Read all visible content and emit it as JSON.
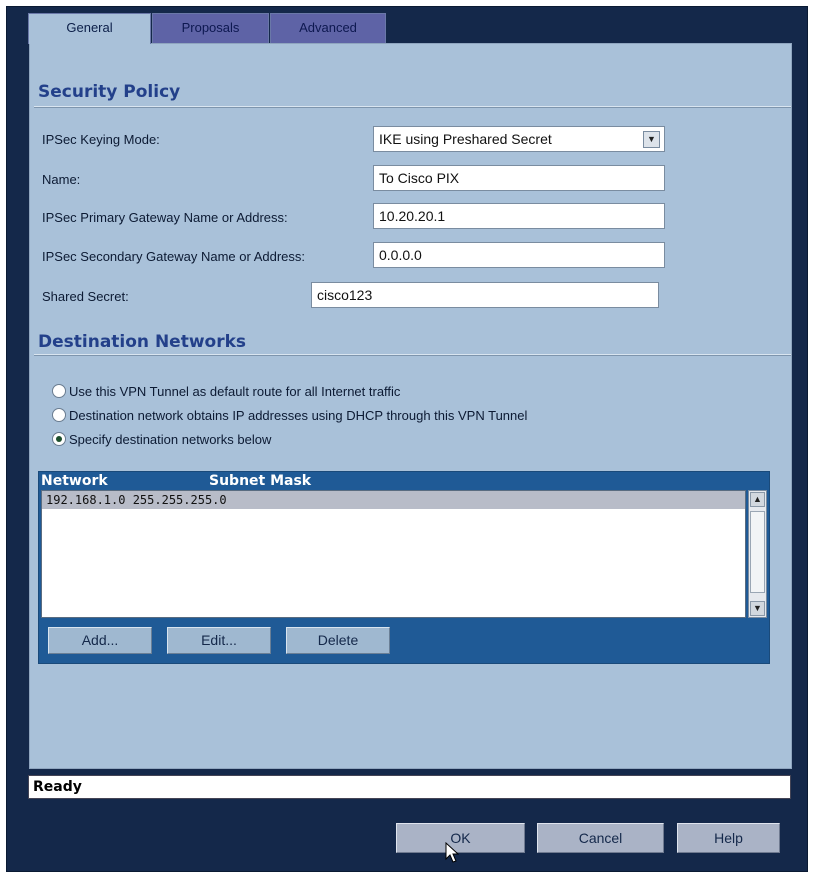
{
  "tabs": [
    {
      "label": "General",
      "active": true
    },
    {
      "label": "Proposals",
      "active": false
    },
    {
      "label": "Advanced",
      "active": false
    }
  ],
  "security_policy": {
    "title": "Security Policy",
    "keying_mode_label": "IPSec Keying Mode:",
    "keying_mode_value": "IKE using Preshared Secret",
    "name_label": "Name:",
    "name_value": "To Cisco PIX",
    "primary_gw_label": "IPSec Primary Gateway Name or Address:",
    "primary_gw_value": "10.20.20.1",
    "secondary_gw_label": "IPSec Secondary Gateway Name or Address:",
    "secondary_gw_value": "0.0.0.0",
    "shared_secret_label": "Shared Secret:",
    "shared_secret_value": "cisco123"
  },
  "destination_networks": {
    "title": "Destination Networks",
    "options": [
      {
        "label": "Use this VPN Tunnel as default route for all Internet traffic",
        "selected": false
      },
      {
        "label": "Destination network obtains IP addresses using DHCP through this VPN Tunnel",
        "selected": false
      },
      {
        "label": "Specify destination networks below",
        "selected": true
      }
    ],
    "table": {
      "columns": [
        "Network",
        "Subnet Mask"
      ],
      "rows": [
        [
          "192.168.1.0",
          "255.255.255.0"
        ]
      ]
    },
    "buttons": {
      "add": "Add...",
      "edit": "Edit...",
      "delete": "Delete"
    }
  },
  "status": {
    "text": "Ready"
  },
  "footer": {
    "ok": "OK",
    "cancel": "Cancel",
    "help": "Help"
  },
  "colors": {
    "frame": "#14284a",
    "panel": "#a9c1d9",
    "section_title": "#23408a",
    "list_header": "#1f5a96",
    "inactive_tab": "#5e63a6"
  }
}
